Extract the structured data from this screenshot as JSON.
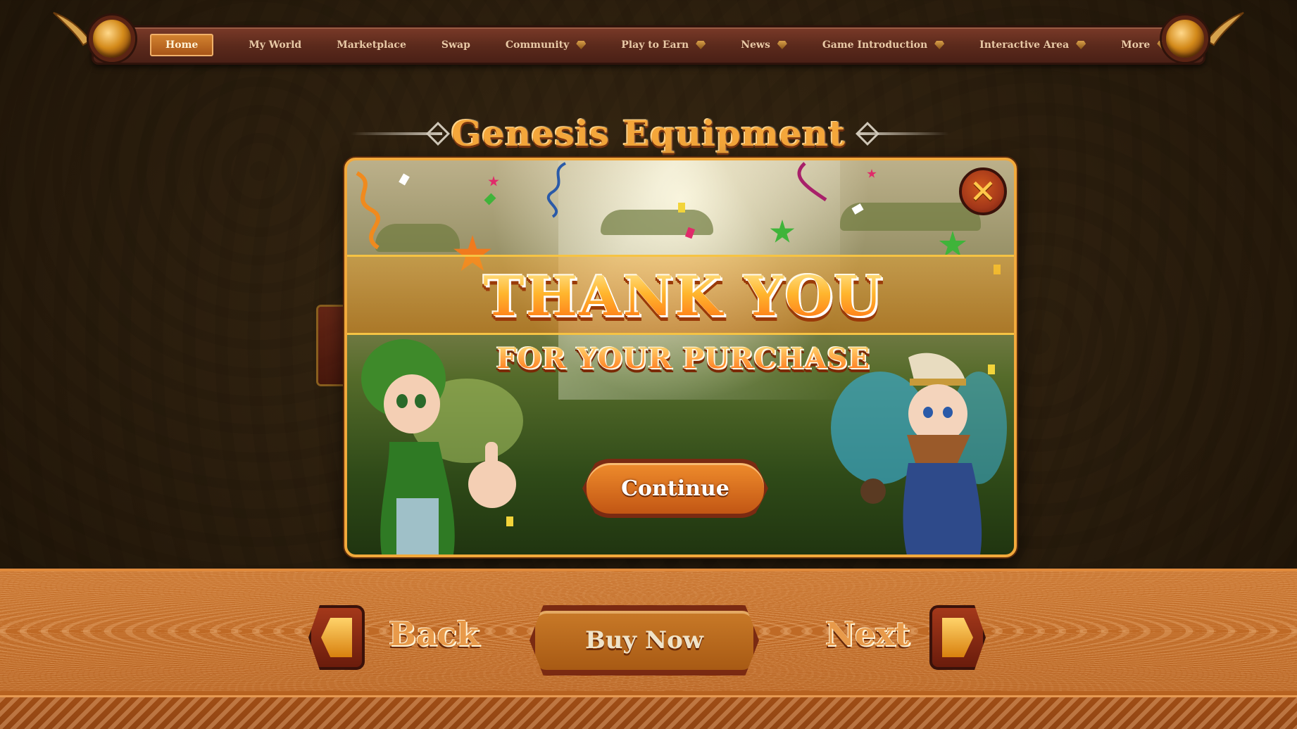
{
  "nav": {
    "items": [
      {
        "label": "Home",
        "active": true,
        "dropdown": false
      },
      {
        "label": "My World",
        "active": false,
        "dropdown": false
      },
      {
        "label": "Marketplace",
        "active": false,
        "dropdown": false
      },
      {
        "label": "Swap",
        "active": false,
        "dropdown": false
      },
      {
        "label": "Community",
        "active": false,
        "dropdown": true
      },
      {
        "label": "Play to Earn",
        "active": false,
        "dropdown": true
      },
      {
        "label": "News",
        "active": false,
        "dropdown": true
      },
      {
        "label": "Game Introduction",
        "active": false,
        "dropdown": true
      },
      {
        "label": "Interactive Area",
        "active": false,
        "dropdown": true
      },
      {
        "label": "More",
        "active": false,
        "dropdown": true
      }
    ]
  },
  "page": {
    "title": "Genesis Equipment"
  },
  "modal": {
    "heading": "THANK YOU",
    "subheading": "FOR YOUR PURCHASE",
    "continue_label": "Continue",
    "close_icon": "close-icon"
  },
  "footer": {
    "back_label": "Back",
    "buy_label": "Buy Now",
    "next_label": "Next"
  },
  "colors": {
    "accent_orange": "#f2a93b",
    "nav_brown": "#5c2a1c",
    "panel_orange": "#c7722c"
  }
}
